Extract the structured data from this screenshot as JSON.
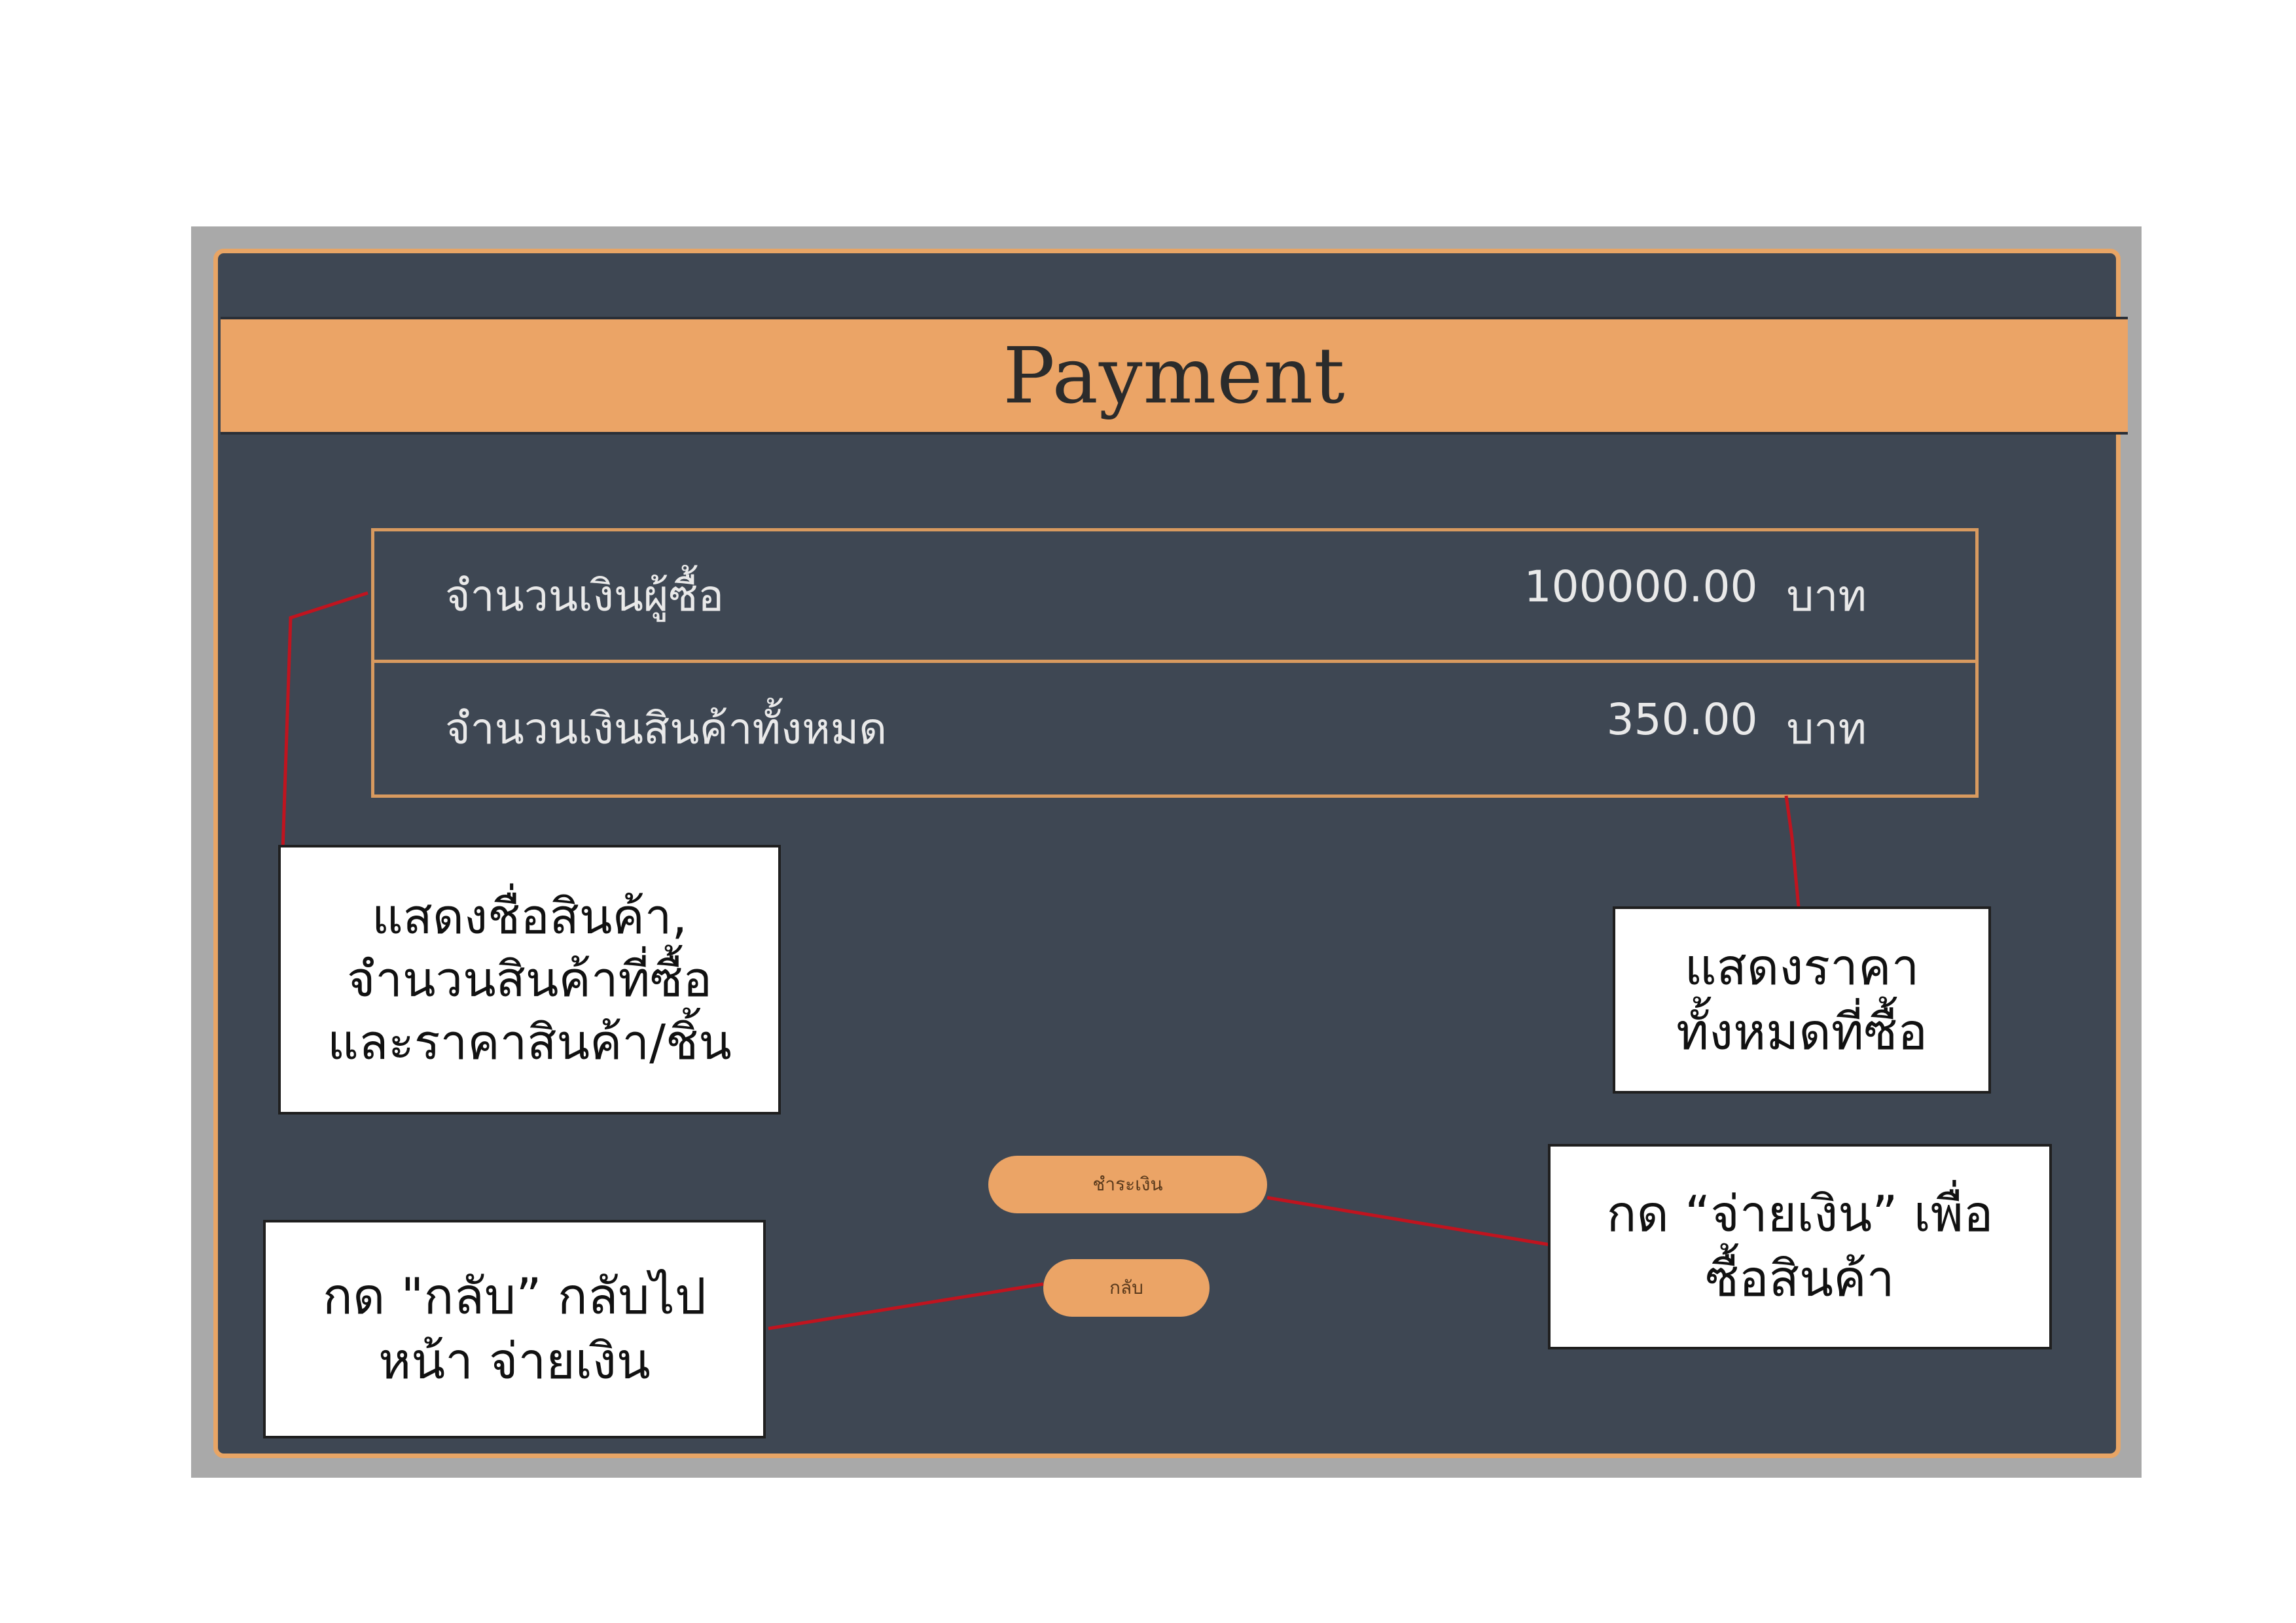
{
  "app": {
    "title": "Payment"
  },
  "summary": {
    "rows": [
      {
        "label": "จำนวนเงินผู้ซื้อ",
        "value": "100000.00",
        "unit": "บาท"
      },
      {
        "label": "จำนวนเงินสินค้าทั้งหมด",
        "value": "350.00",
        "unit": "บาท"
      }
    ]
  },
  "buttons": {
    "pay_label": "ชำระเงิน",
    "back_label": "กลับ"
  },
  "annotations": {
    "product_details": {
      "lines": [
        "แสดงชื่อสินค้า,",
        "จำนวนสินค้าที่ซื้อ",
        "และราคาสินค้า/ชิ้น"
      ]
    },
    "total_price": {
      "lines": [
        "แสดงราคา",
        "ทั้งหมดที่ซื้อ"
      ]
    },
    "pay_hint": {
      "lines": [
        "กด “จ่ายเงิน” เพื่อ",
        "ซื้อสินค้า"
      ]
    },
    "back_hint": {
      "lines": [
        "กด \"กลับ” กลับไป",
        "หน้า จ่ายเงิน"
      ]
    }
  },
  "colors": {
    "background": "#3e4753",
    "accent": "#eba466",
    "annotation_line": "#c0141f"
  }
}
